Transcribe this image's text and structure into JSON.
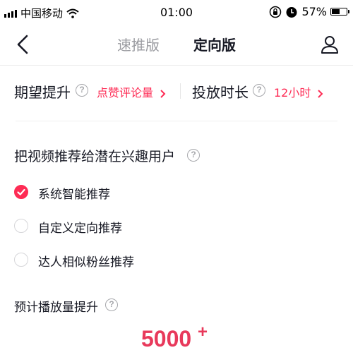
{
  "status_bar": {
    "carrier": "中国移动",
    "time": "01:00",
    "battery": "57%",
    "battery_level": 0.57
  },
  "nav": {
    "back_icon": "chevron-left-icon",
    "tabs": [
      {
        "label": "速推版",
        "active": false
      },
      {
        "label": "定向版",
        "active": true
      }
    ],
    "user_icon": "user-icon"
  },
  "options": {
    "goal_label": "期望提升",
    "goal_value": "点赞评论量",
    "duration_label": "投放时长",
    "duration_value": "12小时"
  },
  "targeting": {
    "title": "把视频推荐给潜在兴趣用户",
    "choices": [
      {
        "label": "系统智能推荐",
        "selected": true
      },
      {
        "label": "自定义定向推荐",
        "selected": false
      },
      {
        "label": "达人相似粉丝推荐",
        "selected": false
      }
    ]
  },
  "estimate": {
    "title": "预计播放量提升",
    "value": "5000",
    "suffix": "+"
  },
  "colors": {
    "accent": "#fe2c55",
    "muted": "#9a9ba0"
  }
}
